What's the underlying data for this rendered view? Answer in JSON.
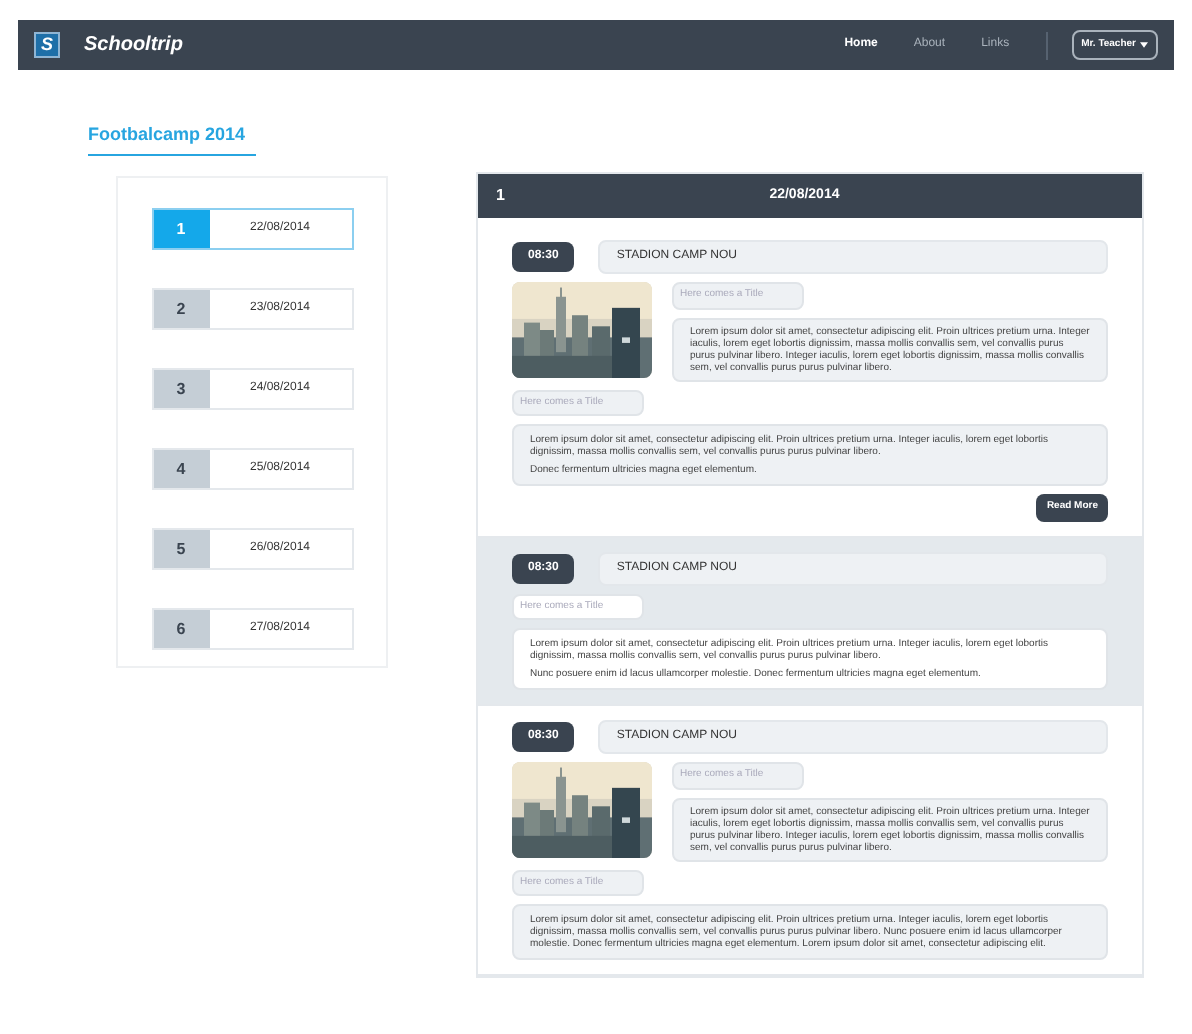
{
  "navbar": {
    "logo_letter": "S",
    "brand": "Schooltrip",
    "links": [
      {
        "label": "Home",
        "selected": true
      },
      {
        "label": "About",
        "selected": false
      },
      {
        "label": "Links",
        "selected": false
      }
    ],
    "user_menu": "Mr. Teacher"
  },
  "page_title": "Footbalcamp 2014",
  "days": [
    {
      "number": "1",
      "date": "22/08/2014",
      "selected": true
    },
    {
      "number": "2",
      "date": "23/08/2014",
      "selected": false
    },
    {
      "number": "3",
      "date": "24/08/2014",
      "selected": false
    },
    {
      "number": "4",
      "date": "25/08/2014",
      "selected": false
    },
    {
      "number": "5",
      "date": "26/08/2014",
      "selected": false
    },
    {
      "number": "6",
      "date": "27/08/2014",
      "selected": false
    }
  ],
  "day_panel": {
    "number": "1",
    "date": "22/08/2014",
    "entries": [
      {
        "highlighted": false,
        "time": "08:30",
        "location": "STADION CAMP NOU",
        "image_title_placeholder": "Here comes a Title",
        "image_text": "Lorem ipsum dolor sit amet, consectetur adipiscing elit. Proin ultrices pretium urna. Integer iaculis, lorem eget lobortis dignissim, massa mollis convallis sem, vel convallis purus purus pulvinar libero. Integer iaculis, lorem eget lobortis dignissim, massa mollis convallis sem, vel convallis purus purus pulvinar libero.",
        "title_placeholder": "Here comes a Title",
        "paragraphs": [
          "Lorem ipsum dolor sit amet, consectetur adipiscing elit. Proin ultrices pretium urna. Integer iaculis, lorem eget lobortis dignissim, massa mollis convallis sem, vel convallis purus purus pulvinar libero.",
          "Donec fermentum ultricies magna eget elementum."
        ],
        "button": "Read More"
      },
      {
        "kind": "text",
        "highlighted": true,
        "time": "08:30",
        "location": "STADION CAMP NOU",
        "title_placeholder": "Here comes a Title",
        "paragraphs": [
          "Lorem ipsum dolor sit amet, consectetur adipiscing elit. Proin ultrices pretium urna. Integer iaculis, lorem eget lobortis dignissim, massa mollis convallis sem, vel convallis purus purus pulvinar libero.",
          "Nunc posuere enim id lacus ullamcorper molestie. Donec fermentum ultricies magna eget elementum."
        ]
      },
      {
        "highlighted": false,
        "time": "08:30",
        "location": "STADION CAMP NOU",
        "image_title_placeholder": "Here comes a Title",
        "image_text": "Lorem ipsum dolor sit amet, consectetur adipiscing elit. Proin ultrices pretium urna. Integer iaculis, lorem eget lobortis dignissim, massa mollis convallis sem, vel convallis purus purus pulvinar libero. Integer iaculis, lorem eget lobortis dignissim, massa mollis convallis sem, vel convallis purus purus pulvinar libero.",
        "title_placeholder": "Here comes a Title",
        "paragraphs": [
          "Lorem ipsum dolor sit amet, consectetur adipiscing elit. Proin ultrices pretium urna. Integer iaculis, lorem eget lobortis dignissim, massa mollis convallis sem, vel convallis purus purus pulvinar libero. Nunc posuere enim id lacus ullamcorper molestie. Donec fermentum ultricies magna eget elementum. Lorem ipsum dolor sit amet, consectetur adipiscing elit."
        ]
      }
    ]
  }
}
